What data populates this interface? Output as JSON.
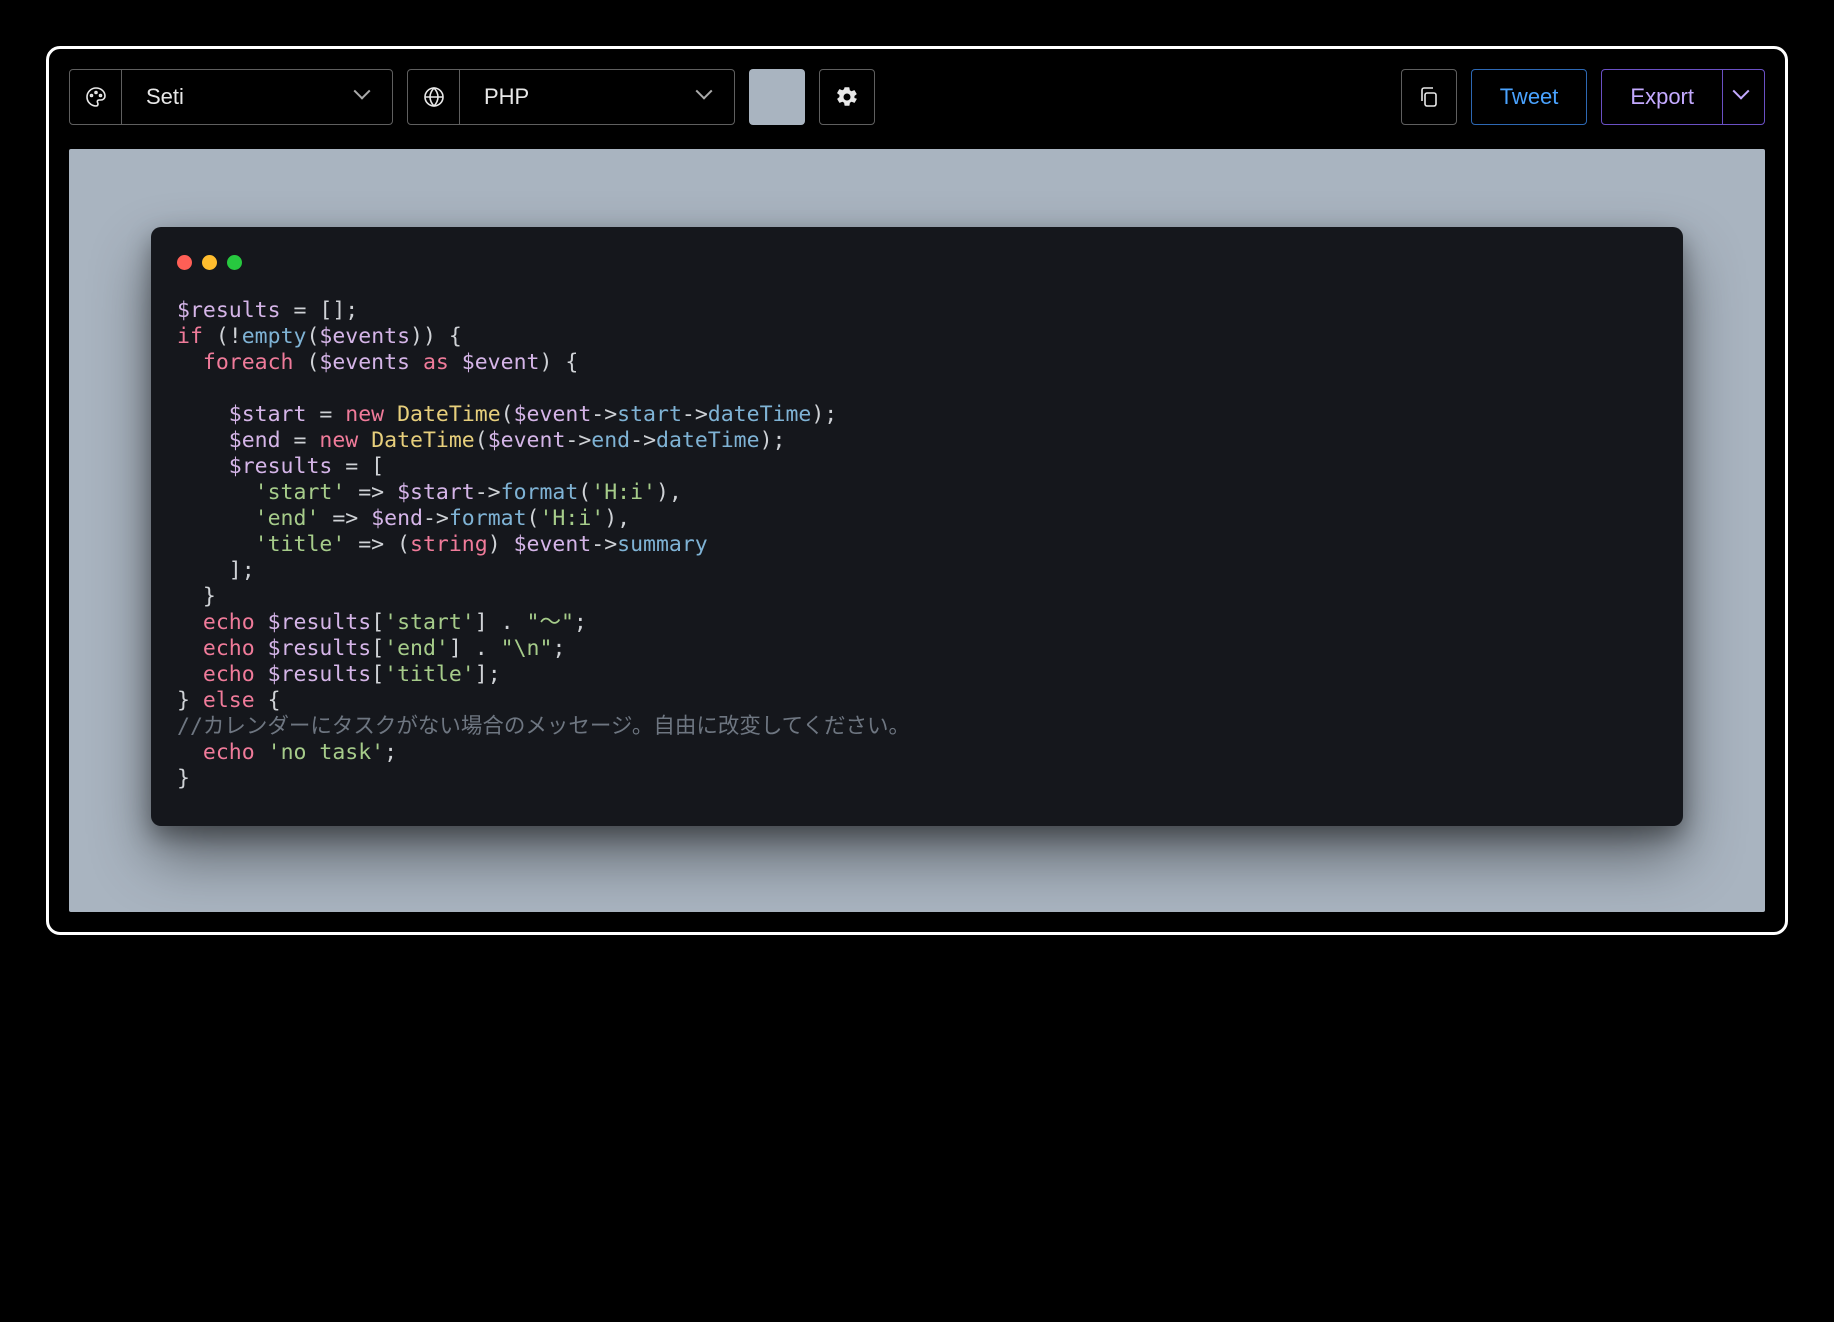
{
  "toolbar": {
    "theme_label": "Seti",
    "language_label": "PHP",
    "tweet_label": "Tweet",
    "export_label": "Export",
    "background_color": "#a9b4c0"
  },
  "code": {
    "tokens": [
      [
        {
          "t": "$results",
          "c": "var"
        },
        {
          "t": " = [];",
          "c": "txt"
        }
      ],
      [
        {
          "t": "if",
          "c": "kw"
        },
        {
          "t": " (!",
          "c": "txt"
        },
        {
          "t": "empty",
          "c": "fn"
        },
        {
          "t": "(",
          "c": "txt"
        },
        {
          "t": "$events",
          "c": "var"
        },
        {
          "t": ")) {",
          "c": "txt"
        }
      ],
      [
        {
          "t": "  ",
          "c": "txt"
        },
        {
          "t": "foreach",
          "c": "kw"
        },
        {
          "t": " (",
          "c": "txt"
        },
        {
          "t": "$events",
          "c": "var"
        },
        {
          "t": " ",
          "c": "txt"
        },
        {
          "t": "as",
          "c": "kw"
        },
        {
          "t": " ",
          "c": "txt"
        },
        {
          "t": "$event",
          "c": "var"
        },
        {
          "t": ") {",
          "c": "txt"
        }
      ],
      [
        {
          "t": "",
          "c": "txt"
        }
      ],
      [
        {
          "t": "    ",
          "c": "txt"
        },
        {
          "t": "$start",
          "c": "var"
        },
        {
          "t": " = ",
          "c": "txt"
        },
        {
          "t": "new",
          "c": "kw"
        },
        {
          "t": " ",
          "c": "txt"
        },
        {
          "t": "DateTime",
          "c": "cls"
        },
        {
          "t": "(",
          "c": "txt"
        },
        {
          "t": "$event",
          "c": "var"
        },
        {
          "t": "->",
          "c": "txt"
        },
        {
          "t": "start",
          "c": "fn"
        },
        {
          "t": "->",
          "c": "txt"
        },
        {
          "t": "dateTime",
          "c": "fn"
        },
        {
          "t": ");",
          "c": "txt"
        }
      ],
      [
        {
          "t": "    ",
          "c": "txt"
        },
        {
          "t": "$end",
          "c": "var"
        },
        {
          "t": " = ",
          "c": "txt"
        },
        {
          "t": "new",
          "c": "kw"
        },
        {
          "t": " ",
          "c": "txt"
        },
        {
          "t": "DateTime",
          "c": "cls"
        },
        {
          "t": "(",
          "c": "txt"
        },
        {
          "t": "$event",
          "c": "var"
        },
        {
          "t": "->",
          "c": "txt"
        },
        {
          "t": "end",
          "c": "fn"
        },
        {
          "t": "->",
          "c": "txt"
        },
        {
          "t": "dateTime",
          "c": "fn"
        },
        {
          "t": ");",
          "c": "txt"
        }
      ],
      [
        {
          "t": "    ",
          "c": "txt"
        },
        {
          "t": "$results",
          "c": "var"
        },
        {
          "t": " = [",
          "c": "txt"
        }
      ],
      [
        {
          "t": "      ",
          "c": "txt"
        },
        {
          "t": "'start'",
          "c": "str"
        },
        {
          "t": " => ",
          "c": "txt"
        },
        {
          "t": "$start",
          "c": "var"
        },
        {
          "t": "->",
          "c": "txt"
        },
        {
          "t": "format",
          "c": "fn"
        },
        {
          "t": "(",
          "c": "txt"
        },
        {
          "t": "'H:i'",
          "c": "str"
        },
        {
          "t": "),",
          "c": "txt"
        }
      ],
      [
        {
          "t": "      ",
          "c": "txt"
        },
        {
          "t": "'end'",
          "c": "str"
        },
        {
          "t": " => ",
          "c": "txt"
        },
        {
          "t": "$end",
          "c": "var"
        },
        {
          "t": "->",
          "c": "txt"
        },
        {
          "t": "format",
          "c": "fn"
        },
        {
          "t": "(",
          "c": "txt"
        },
        {
          "t": "'H:i'",
          "c": "str"
        },
        {
          "t": "),",
          "c": "txt"
        }
      ],
      [
        {
          "t": "      ",
          "c": "txt"
        },
        {
          "t": "'title'",
          "c": "str"
        },
        {
          "t": " => (",
          "c": "txt"
        },
        {
          "t": "string",
          "c": "kw"
        },
        {
          "t": ") ",
          "c": "txt"
        },
        {
          "t": "$event",
          "c": "var"
        },
        {
          "t": "->",
          "c": "txt"
        },
        {
          "t": "summary",
          "c": "fn"
        }
      ],
      [
        {
          "t": "    ];",
          "c": "txt"
        }
      ],
      [
        {
          "t": "  }",
          "c": "txt"
        }
      ],
      [
        {
          "t": "  ",
          "c": "txt"
        },
        {
          "t": "echo",
          "c": "kw"
        },
        {
          "t": " ",
          "c": "txt"
        },
        {
          "t": "$results",
          "c": "var"
        },
        {
          "t": "[",
          "c": "txt"
        },
        {
          "t": "'start'",
          "c": "str"
        },
        {
          "t": "] . ",
          "c": "txt"
        },
        {
          "t": "\"〜\"",
          "c": "str"
        },
        {
          "t": ";",
          "c": "txt"
        }
      ],
      [
        {
          "t": "  ",
          "c": "txt"
        },
        {
          "t": "echo",
          "c": "kw"
        },
        {
          "t": " ",
          "c": "txt"
        },
        {
          "t": "$results",
          "c": "var"
        },
        {
          "t": "[",
          "c": "txt"
        },
        {
          "t": "'end'",
          "c": "str"
        },
        {
          "t": "] . ",
          "c": "txt"
        },
        {
          "t": "\"\\n\"",
          "c": "str"
        },
        {
          "t": ";",
          "c": "txt"
        }
      ],
      [
        {
          "t": "  ",
          "c": "txt"
        },
        {
          "t": "echo",
          "c": "kw"
        },
        {
          "t": " ",
          "c": "txt"
        },
        {
          "t": "$results",
          "c": "var"
        },
        {
          "t": "[",
          "c": "txt"
        },
        {
          "t": "'title'",
          "c": "str"
        },
        {
          "t": "];",
          "c": "txt"
        }
      ],
      [
        {
          "t": "} ",
          "c": "txt"
        },
        {
          "t": "else",
          "c": "kw"
        },
        {
          "t": " {",
          "c": "txt"
        }
      ],
      [
        {
          "t": "//カレンダーにタスクがない場合のメッセージ。自由に改変してください。",
          "c": "cmt"
        }
      ],
      [
        {
          "t": "  ",
          "c": "txt"
        },
        {
          "t": "echo",
          "c": "kw"
        },
        {
          "t": " ",
          "c": "txt"
        },
        {
          "t": "'no task'",
          "c": "str"
        },
        {
          "t": ";",
          "c": "txt"
        }
      ],
      [
        {
          "t": "}",
          "c": "txt"
        }
      ]
    ]
  }
}
